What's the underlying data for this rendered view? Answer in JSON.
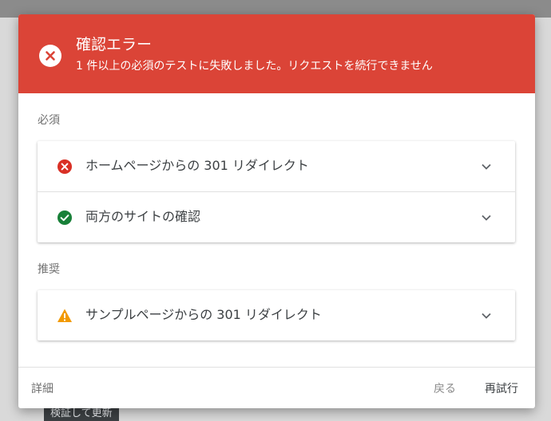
{
  "background": {
    "button_label": "検証して更新"
  },
  "dialog": {
    "title": "確認エラー",
    "subtitle": "1 件以上の必須のテストに失敗しました。リクエストを続行できません",
    "header_color": "#db4437",
    "header_icon": "error-circle-icon",
    "sections": {
      "required": {
        "label": "必須",
        "items": [
          {
            "label": "ホームページからの 301 リダイレクト",
            "status": "error",
            "icon": "error-icon",
            "color": "#d93025"
          },
          {
            "label": "両方のサイトの確認",
            "status": "success",
            "icon": "check-circle-icon",
            "color": "#188038"
          }
        ]
      },
      "recommended": {
        "label": "推奨",
        "items": [
          {
            "label": "サンプルページからの 301 リダイレクト",
            "status": "warning",
            "icon": "warning-icon",
            "color": "#f29900"
          }
        ]
      }
    },
    "footer": {
      "details_label": "詳細",
      "back_label": "戻る",
      "retry_label": "再試行"
    }
  }
}
